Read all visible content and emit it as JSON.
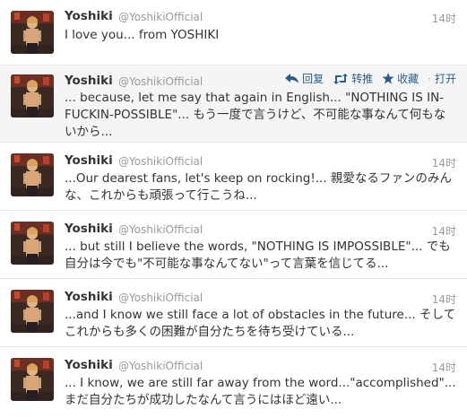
{
  "colors": {
    "link": "#2b5d87",
    "muted": "#999999",
    "text": "#333333",
    "hover_bg": "#f5f5f5"
  },
  "actions": {
    "reply": "回复",
    "retweet": "转推",
    "favorite": "收藏",
    "open": "打开"
  },
  "tweets": [
    {
      "name": "Yoshiki",
      "handle": "@YoshikiOfficial",
      "time": "14时",
      "text": "I love you... from YOSHIKI"
    },
    {
      "name": "Yoshiki",
      "handle": "@YoshikiOfficial",
      "time": "",
      "text": "... because, let me say that again in English... \"NOTHING IS IN-FUCKIN-POSSIBLE\"... もう一度で言うけど、不可能な事なんて何もないから..."
    },
    {
      "name": "Yoshiki",
      "handle": "@YoshikiOfficial",
      "time": "14时",
      "text": "...Our dearest fans, let's keep on rocking!... 親愛なるファンのみんな、これからも頑張って行こうね..."
    },
    {
      "name": "Yoshiki",
      "handle": "@YoshikiOfficial",
      "time": "14时",
      "text": "... but still I believe the words, \"NOTHING IS IMPOSSIBLE\"... でも自分は今でも\"不可能な事なんてない\"って言葉を信じてる..."
    },
    {
      "name": "Yoshiki",
      "handle": "@YoshikiOfficial",
      "time": "14时",
      "text": "...and I know we still face a lot of obstacles in the future... そしてこれからも多くの困難が自分たちを待ち受けている..."
    },
    {
      "name": "Yoshiki",
      "handle": "@YoshikiOfficial",
      "time": "14时",
      "text": "... I know, we are still far away from the word...\"accomplished\"... まだ自分たちが成功したなんて言うにはほど遠い..."
    }
  ]
}
